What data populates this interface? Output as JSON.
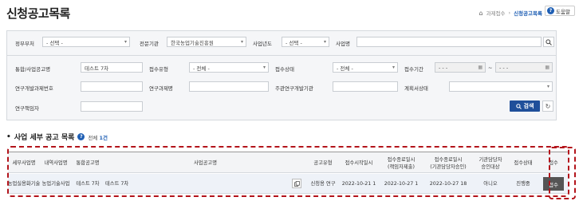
{
  "page": {
    "title": "신청공고목록",
    "breadcrumb": [
      "과제접수",
      "신청공고목록"
    ],
    "help_label": "도움말"
  },
  "search": {
    "ministry_label": "정부부처",
    "ministry_value": "- 선택 -",
    "agency_label": "전문기관",
    "agency_value": "한국농업기술진흥원",
    "year_label": "사업년도",
    "year_value": "- 선택 -",
    "business_label": "사업명",
    "business_value": "",
    "program_label": "통합/사업공고명",
    "program_value": "테스트 7차",
    "receipt_type_label": "접수유형",
    "receipt_type_value": "- 전체 -",
    "receipt_status_label": "접수상태",
    "receipt_status_value": "- 전체 -",
    "period_label": "접수기간",
    "period_from": "- - -",
    "period_to": "- - -",
    "rnd_no_label": "연구개발과제번호",
    "rnd_title_label": "연구과제명",
    "lead_agency_label": "주관연구개발기관",
    "plan_status_label": "계획서상태",
    "researcher_label": "연구책임자",
    "search_button": "검색"
  },
  "list": {
    "title": "사업 세부 공고 목록",
    "count_prefix": "전체",
    "count": "1건",
    "columns": [
      "세부사업명",
      "내역사업명",
      "통합공고명",
      "사업공고명",
      "공고유형",
      "접수시작일시",
      "접수종료일시\n(책임자제출)",
      "접수종료일시\n(기관담당자승인)",
      "기관담당자\n승인대상",
      "접수상태",
      "접수"
    ],
    "rows": [
      {
        "detail_business": "농업실용화기술",
        "item_business": "농업기술사업",
        "integrated_notice": "테스트 7차",
        "business_notice": "테스트 7차",
        "notice_type": "신청용 연구",
        "start": "2022-10-21 1",
        "end_researcher": "2022-10-27 1",
        "end_agency": "2022-10-27 18",
        "approval_target": "아니오",
        "status": "진행중",
        "apply_label": "접수"
      }
    ]
  },
  "colors": {
    "accent": "#1f5fb4",
    "search_button": "#1f4f9a",
    "highlight_dash": "#b3141b"
  }
}
